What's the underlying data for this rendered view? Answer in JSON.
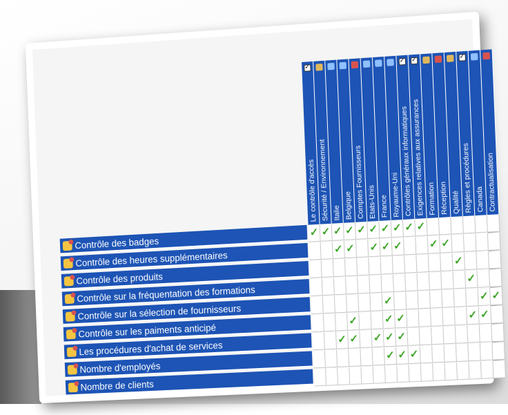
{
  "columns": [
    {
      "label": "Le contrôle d'accès",
      "icon": "check-icon"
    },
    {
      "label": "Sécurité / Environnement",
      "icon": "people-icon"
    },
    {
      "label": "Italie",
      "icon": "person-icon"
    },
    {
      "label": "Belgique",
      "icon": "person-icon"
    },
    {
      "label": "Comptes Fournisseurs",
      "icon": "box-icon"
    },
    {
      "label": "Etats-Unis",
      "icon": "person-icon"
    },
    {
      "label": "France",
      "icon": "person-icon"
    },
    {
      "label": "Royaume-Uni",
      "icon": "person-icon"
    },
    {
      "label": "Contrôles généraux informatiques",
      "icon": "check-icon"
    },
    {
      "label": "Exigences relatives aux assurances",
      "icon": "check-icon"
    },
    {
      "label": "Formation",
      "icon": "people-icon"
    },
    {
      "label": "Réception",
      "icon": "box-icon"
    },
    {
      "label": "Qualité",
      "icon": "people-icon"
    },
    {
      "label": "Règles et procédures",
      "icon": "check-icon"
    },
    {
      "label": "Canada",
      "icon": "person-icon"
    },
    {
      "label": "Contractualisation",
      "icon": "box-icon"
    }
  ],
  "rows": [
    {
      "label": "Contrôle des badges",
      "checks": [
        0,
        1,
        2,
        3,
        4,
        5,
        6,
        7,
        8,
        9
      ]
    },
    {
      "label": "Contrôle des heures supplémentaires",
      "checks": [
        2,
        3,
        5,
        6,
        7,
        10,
        11
      ]
    },
    {
      "label": "Contrôle des produits",
      "checks": [
        12
      ]
    },
    {
      "label": "Contrôle sur la fréquentation des formations",
      "checks": [
        13
      ]
    },
    {
      "label": "Contrôle sur la sélection de fournisseurs",
      "checks": [
        6,
        14,
        15
      ]
    },
    {
      "label": "Contrôle sur les paiments anticipé",
      "checks": [
        3,
        6,
        7,
        13,
        14
      ]
    },
    {
      "label": "Les procédures d'achat de services",
      "checks": [
        2,
        3,
        5,
        6,
        7
      ]
    },
    {
      "label": "Nombre d'employés",
      "checks": [
        6,
        7,
        8
      ]
    },
    {
      "label": "Nombre de clients",
      "checks": []
    }
  ],
  "check_mark": "✓",
  "colors": {
    "header_blue": "#1d54b5",
    "check_green": "#3aa324"
  }
}
